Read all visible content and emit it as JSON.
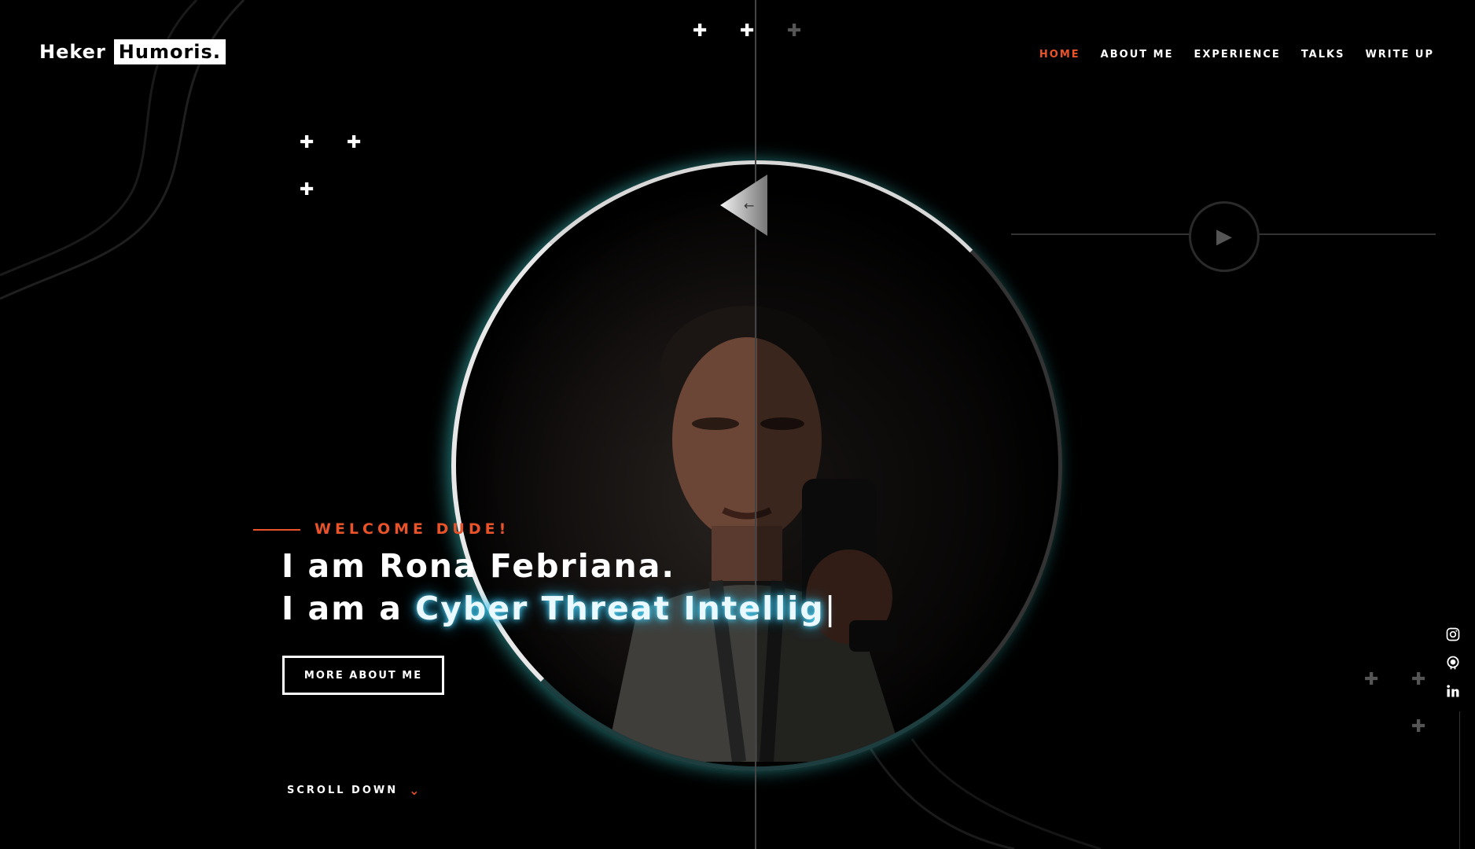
{
  "logo": {
    "text_plain": "Heker",
    "text_boxed": "Humoris."
  },
  "nav": {
    "items": [
      {
        "label": "HOME",
        "active": true
      },
      {
        "label": "ABOUT ME",
        "active": false
      },
      {
        "label": "EXPERIENCE",
        "active": false
      },
      {
        "label": "TALKS",
        "active": false
      },
      {
        "label": "WRITE UP",
        "active": false
      }
    ]
  },
  "hero": {
    "welcome": "WELCOME DUDE!",
    "name_line": "I am Rona Febriana.",
    "role_prefix": "I am a ",
    "role_typed": "Cyber Threat Intellig",
    "caret": "|",
    "button_label": "MORE ABOUT ME",
    "scroll_label": "SCROLL DOWN"
  },
  "icons": {
    "back_arrow": "arrow-left-icon",
    "play": "play-icon",
    "scroll": "chevron-down-icon",
    "socials": [
      "instagram-icon",
      "github-icon",
      "linkedin-icon"
    ]
  },
  "colors": {
    "accent": "#e8532a",
    "glow": "#4fd9ff",
    "background": "#000000"
  }
}
